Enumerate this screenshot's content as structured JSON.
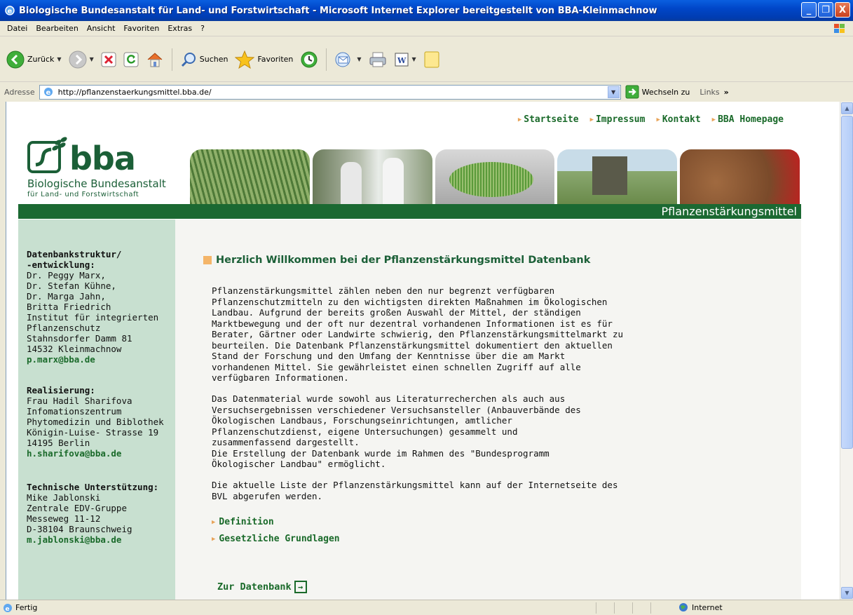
{
  "window": {
    "title": "Biologische Bundesanstalt für Land- und Forstwirtschaft - Microsoft Internet Explorer bereitgestellt von BBA-Kleinmachnow",
    "minimize": "_",
    "maximize": "❐",
    "close": "X"
  },
  "menubar": [
    "Datei",
    "Bearbeiten",
    "Ansicht",
    "Favoriten",
    "Extras",
    "?"
  ],
  "toolbar": {
    "back_label": "Zurück",
    "search_label": "Suchen",
    "favorites_label": "Favoriten"
  },
  "address": {
    "label": "Adresse",
    "url": "http://pflanzenstaerkungsmittel.bba.de/",
    "go_label": "Wechseln zu",
    "links_label": "Links"
  },
  "site": {
    "topnav": [
      "Startseite",
      "Impressum",
      "Kontakt",
      "BBA Homepage"
    ],
    "logo": {
      "name": "bba",
      "line1": "Biologische Bundesanstalt",
      "line2": "für Land- und Forstwirtschaft"
    },
    "banner_title": "Pflanzenstärkungsmittel",
    "sidebar": [
      {
        "heading1": "Datenbankstruktur/",
        "heading2": "-entwicklung:",
        "lines": [
          "Dr. Peggy Marx,",
          "Dr. Stefan Kühne,",
          "Dr. Marga Jahn,",
          "Britta Friedrich",
          "Institut für integrierten",
          "Pflanzenschutz",
          "Stahnsdorfer Damm 81",
          "14532 Kleinmachnow"
        ],
        "email": "p.marx@bba.de"
      },
      {
        "heading1": "Realisierung:",
        "lines": [
          "Frau Hadil Sharifova",
          "Infomationszentrum",
          "Phytomedizin und Biblothek",
          "Königin-Luise- Strasse 19",
          "14195 Berlin"
        ],
        "email": "h.sharifova@bba.de"
      },
      {
        "heading1": "Technische Unterstützung:",
        "lines": [
          "Mike Jablonski",
          "Zentrale EDV-Gruppe",
          "Messeweg 11-12",
          "D-38104 Braunschweig"
        ],
        "email": "m.jablonski@bba.de"
      }
    ],
    "content": {
      "heading": "Herzlich Willkommen bei der Pflanzenstärkungsmittel Datenbank",
      "para1": [
        "Pflanzenstärkungsmittel zählen neben den nur begrenzt verfügbaren",
        "Pflanzenschutzmitteln zu den wichtigsten direkten Maßnahmen im Ökologischen",
        "Landbau. Aufgrund der bereits großen Auswahl der Mittel, der ständigen",
        "Marktbewegung und der oft nur dezentral vorhandenen Informationen ist es für",
        "Berater, Gärtner oder Landwirte schwierig, den Pflanzenstärkungsmittelmarkt zu",
        "beurteilen. Die Datenbank Pflanzenstärkungsmittel dokumentiert den aktuellen",
        "Stand der Forschung und den Umfang der Kenntnisse über die am Markt",
        "vorhandenen Mittel. Sie gewährleistet einen schnellen Zugriff auf alle",
        "verfügbaren Informationen."
      ],
      "para2": [
        "Das Datenmaterial wurde sowohl aus Literaturrecherchen als auch aus",
        "Versuchsergebnissen verschiedener Versuchsansteller (Anbauverbände des",
        "Ökologischen Landbaus, Forschungseinrichtungen, amtlicher",
        "Pflanzenschutzdienst, eigene Untersuchungen) gesammelt und",
        "zusammenfassend dargestellt.",
        "Die Erstellung der Datenbank wurde im Rahmen des \"Bundesprogramm",
        "Ökologischer Landbau\" ermöglicht."
      ],
      "para3": [
        "Die aktuelle Liste der Pflanzenstärkungsmittel kann auf der Internetseite des",
        "BVL abgerufen werden."
      ],
      "link_definition": "Definition",
      "link_grundlagen": "Gesetzliche Grundlagen",
      "zur_datenbank": "Zur Datenbank"
    }
  },
  "status": {
    "left": "Fertig",
    "zone": "Internet"
  }
}
